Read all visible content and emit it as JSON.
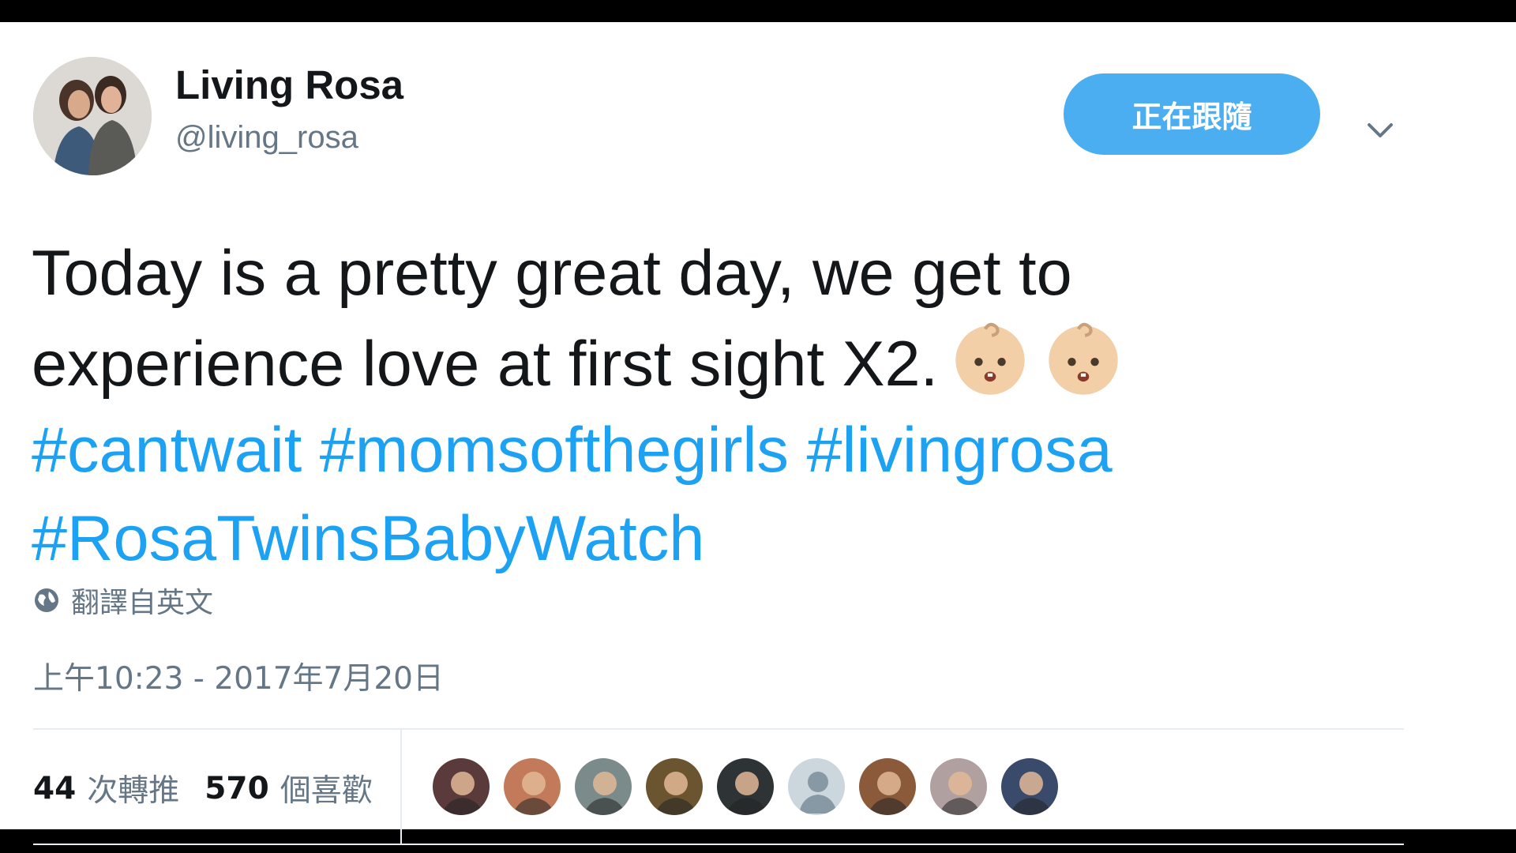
{
  "profile": {
    "display_name": "Living Rosa",
    "handle": "@living_rosa"
  },
  "follow_button": {
    "label": "正在跟隨"
  },
  "tweet": {
    "line1": "Today is a pretty great day, we get to",
    "line2": "experience love at first sight X2.",
    "emojis": [
      "baby-icon",
      "baby-icon"
    ],
    "hashtags": [
      "#cantwait",
      "#momsofthegirls",
      "#livingrosa",
      "#RosaTwinsBabyWatch"
    ]
  },
  "translate": {
    "label": "翻譯自英文"
  },
  "timestamp": "上午10:23 - 2017年7月20日",
  "stats": {
    "retweets_count": "44",
    "retweets_label": "次轉推",
    "likes_count": "570",
    "likes_label": "個喜歡"
  },
  "likers": [
    {
      "icon": "avatar-icon",
      "color": "#5a3a3a"
    },
    {
      "icon": "avatar-icon",
      "color": "#c27a5a"
    },
    {
      "icon": "avatar-icon",
      "color": "#7b8a8a"
    },
    {
      "icon": "avatar-icon",
      "color": "#6b5530"
    },
    {
      "icon": "avatar-icon",
      "color": "#2e3436"
    },
    {
      "icon": "default-avatar-icon",
      "color": "#ccd6dd"
    },
    {
      "icon": "avatar-icon",
      "color": "#8a5a3a"
    },
    {
      "icon": "avatar-icon",
      "color": "#b0a0a0"
    },
    {
      "icon": "avatar-icon",
      "color": "#3a4a6a"
    }
  ],
  "colors": {
    "accent": "#1da1f2",
    "follow_button": "#4aaef0",
    "secondary_text": "#657786"
  }
}
